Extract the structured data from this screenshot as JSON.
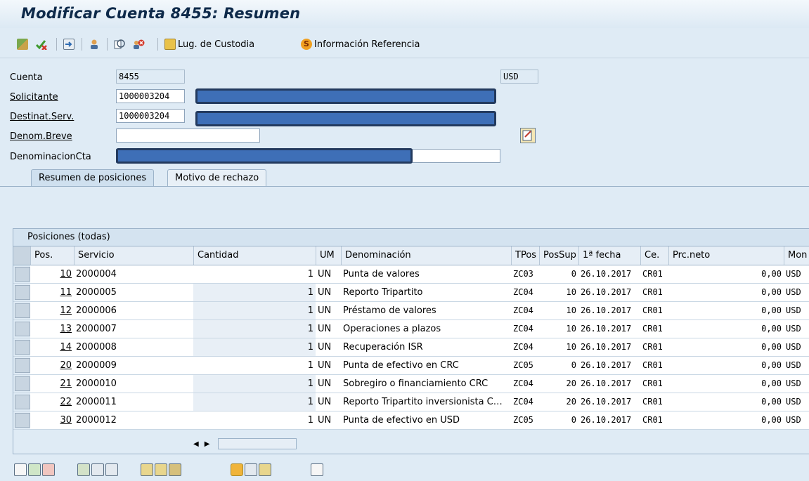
{
  "window": {
    "title": "Modificar Cuenta 8455: Resumen"
  },
  "toolbar": {
    "items": [
      {
        "icon": "sort-icon",
        "label": ""
      },
      {
        "icon": "check-icon",
        "label": ""
      },
      {
        "icon": "export-icon",
        "label": ""
      },
      {
        "icon": "person-icon",
        "label": ""
      },
      {
        "icon": "copy-icon",
        "label": ""
      },
      {
        "icon": "delete-partner-icon",
        "label": ""
      }
    ],
    "lug_custodia": "Lug. de Custodia",
    "info_referencia": "Información Referencia"
  },
  "header": {
    "cuenta_label": "Cuenta",
    "cuenta_value": "8455",
    "moneda": "USD",
    "solicitante_label": "Solicitante",
    "solicitante_value": "1000003204",
    "destinatario_label": "Destinat.Serv.",
    "destinatario_value": "1000003204",
    "denom_breve_label": "Denom.Breve",
    "denom_breve_value": "",
    "denominacion_label": "DenominacionCta"
  },
  "tabs": [
    "Resumen de posiciones",
    "Motivo de rechazo"
  ],
  "grid": {
    "title": "Posiciones (todas)",
    "columns": [
      "Pos.",
      "Servicio",
      "Cantidad",
      "UM",
      "Denominación",
      "TPos",
      "PosSup",
      "1ª fecha",
      "Ce.",
      "Prc.neto",
      "Mon"
    ],
    "rows": [
      {
        "pos": "10",
        "servicio": "2000004",
        "cantidad": "1",
        "um": "UN",
        "denom": "Punta de valores",
        "tpos": "ZC03",
        "possup": "0",
        "fecha": "26.10.2017",
        "ce": "CR01",
        "prc": "0,00",
        "mon": "USD"
      },
      {
        "pos": "11",
        "servicio": "2000005",
        "cantidad": "1",
        "um": "UN",
        "denom": "Reporto Tripartito",
        "tpos": "ZC04",
        "possup": "10",
        "fecha": "26.10.2017",
        "ce": "CR01",
        "prc": "0,00",
        "mon": "USD"
      },
      {
        "pos": "12",
        "servicio": "2000006",
        "cantidad": "1",
        "um": "UN",
        "denom": "Préstamo de valores",
        "tpos": "ZC04",
        "possup": "10",
        "fecha": "26.10.2017",
        "ce": "CR01",
        "prc": "0,00",
        "mon": "USD"
      },
      {
        "pos": "13",
        "servicio": "2000007",
        "cantidad": "1",
        "um": "UN",
        "denom": "Operaciones a plazos",
        "tpos": "ZC04",
        "possup": "10",
        "fecha": "26.10.2017",
        "ce": "CR01",
        "prc": "0,00",
        "mon": "USD"
      },
      {
        "pos": "14",
        "servicio": "2000008",
        "cantidad": "1",
        "um": "UN",
        "denom": "Recuperación ISR",
        "tpos": "ZC04",
        "possup": "10",
        "fecha": "26.10.2017",
        "ce": "CR01",
        "prc": "0,00",
        "mon": "USD"
      },
      {
        "pos": "20",
        "servicio": "2000009",
        "cantidad": "1",
        "um": "UN",
        "denom": "Punta de efectivo en CRC",
        "tpos": "ZC05",
        "possup": "0",
        "fecha": "26.10.2017",
        "ce": "CR01",
        "prc": "0,00",
        "mon": "USD"
      },
      {
        "pos": "21",
        "servicio": "2000010",
        "cantidad": "1",
        "um": "UN",
        "denom": "Sobregiro o financiamiento CRC",
        "tpos": "ZC04",
        "possup": "20",
        "fecha": "26.10.2017",
        "ce": "CR01",
        "prc": "0,00",
        "mon": "USD"
      },
      {
        "pos": "22",
        "servicio": "2000011",
        "cantidad": "1",
        "um": "UN",
        "denom": "Reporto Tripartito inversionista C…",
        "tpos": "ZC04",
        "possup": "20",
        "fecha": "26.10.2017",
        "ce": "CR01",
        "prc": "0,00",
        "mon": "USD"
      },
      {
        "pos": "30",
        "servicio": "2000012",
        "cantidad": "1",
        "um": "UN",
        "denom": "Punta de efectivo en USD",
        "tpos": "ZC05",
        "possup": "0",
        "fecha": "26.10.2017",
        "ce": "CR01",
        "prc": "0,00",
        "mon": "USD"
      }
    ]
  },
  "colors": {
    "background": "#dfebf5",
    "title": "#0e2a4a",
    "redaction": "#3e6fb7"
  }
}
